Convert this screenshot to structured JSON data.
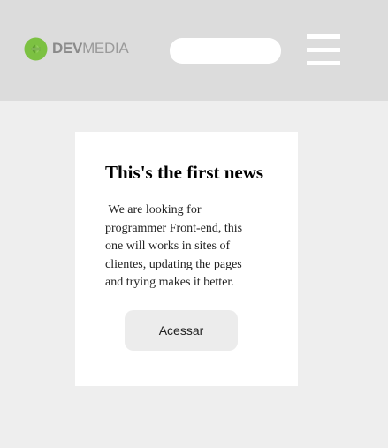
{
  "header": {
    "logo": {
      "icon": "devmedia-logo-icon",
      "text_bold": "DEV",
      "text_light": "MEDIA",
      "icon_color": "#7cc142"
    },
    "search": {
      "placeholder": "",
      "value": ""
    },
    "menu": {
      "icon": "hamburger-menu-icon"
    },
    "background": "#dcdcdc"
  },
  "news": {
    "title": "This's the first news",
    "body": " We are looking for programmer Front-end, this one will works in sites of clientes, updating the pages and trying makes it better.",
    "button_label": "Acessar"
  },
  "colors": {
    "page_background": "#eeeeee",
    "card_background": "#ffffff",
    "button_background": "#ececec"
  }
}
